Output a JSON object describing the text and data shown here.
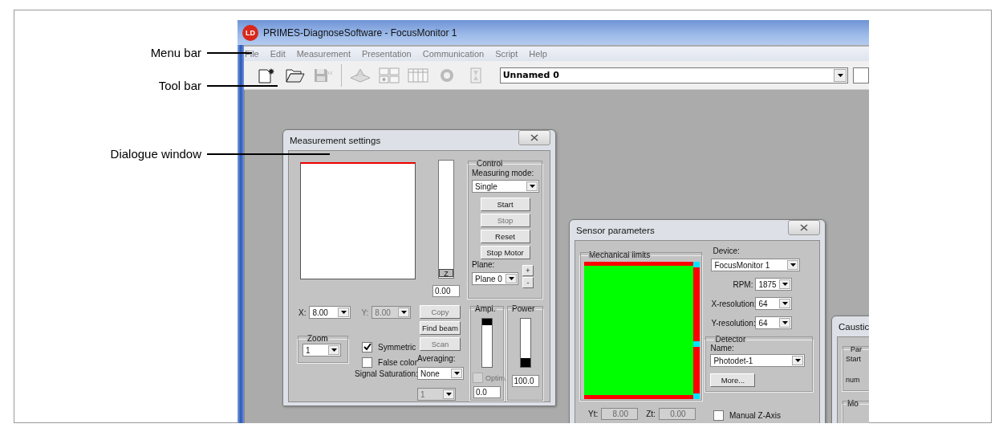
{
  "callouts": [
    {
      "label": "Menu bar"
    },
    {
      "label": "Tool bar"
    },
    {
      "label": "Dialogue window"
    }
  ],
  "app": {
    "logo": "LD",
    "title": "PRIMES-DiagnoseSoftware - FocusMonitor 1",
    "menu": [
      "File",
      "Edit",
      "Measurement",
      "Presentation",
      "Communication",
      "Script",
      "Help"
    ],
    "toolbar": [
      {
        "kind": "new",
        "disabled": false
      },
      {
        "kind": "open",
        "disabled": false
      },
      {
        "kind": "save",
        "disabled": true
      },
      {
        "kind": "separator"
      },
      {
        "kind": "plot3d",
        "disabled": true
      },
      {
        "kind": "layout",
        "disabled": true
      },
      {
        "kind": "table",
        "disabled": true
      },
      {
        "kind": "ring",
        "disabled": true
      },
      {
        "kind": "hourglass",
        "disabled": true
      }
    ],
    "document": "Unnamed 0"
  },
  "measurement_settings": {
    "title": "Measurement settings",
    "z_label": "Z",
    "z_value": "0.00",
    "control": {
      "legend": "Control",
      "mode_label": "Measuring mode:",
      "mode": "Single",
      "buttons": [
        {
          "label": "Start",
          "disabled": false
        },
        {
          "label": "Stop",
          "disabled": true
        },
        {
          "label": "Reset",
          "disabled": false
        },
        {
          "label": "Stop Motor",
          "disabled": false
        }
      ],
      "plane_label": "Plane:",
      "plane": "Plane 0",
      "plus": "+",
      "minus": "-"
    },
    "x": {
      "label": "X:",
      "value": "8.00",
      "disabled": false
    },
    "y": {
      "label": "Y:",
      "value": "8.00",
      "disabled": true
    },
    "actions": [
      {
        "label": "Copy",
        "disabled": true
      },
      {
        "label": "Find beam",
        "disabled": false
      },
      {
        "label": "Scan",
        "disabled": true
      }
    ],
    "zoom": {
      "legend": "Zoom",
      "value": "1"
    },
    "checks": [
      {
        "label": "Symmetric",
        "checked": true
      },
      {
        "label": "False color",
        "checked": false
      }
    ],
    "saturation_label": "Signal Saturation:",
    "saturation": {
      "value": "1",
      "disabled": true
    },
    "averaging_label": "Averaging:",
    "averaging": "None",
    "meters": [
      {
        "kind": "amplitude",
        "legend": "Ampl.",
        "level": 0.13,
        "value": "0.0",
        "optim": {
          "label": "Optim.",
          "checked": false,
          "disabled": true
        }
      },
      {
        "kind": "power",
        "legend": "Power",
        "level": 0.18,
        "value": "100.0"
      }
    ]
  },
  "sensor_parameters": {
    "title": "Sensor parameters",
    "limits_legend": "Mechanical limits",
    "device_label": "Device:",
    "device": "FocusMonitor 1",
    "settings": [
      {
        "label": "RPM:",
        "value": "1875"
      },
      {
        "label": "X-resolution:",
        "value": "64"
      },
      {
        "label": "Y-resolution:",
        "value": "64"
      }
    ],
    "detector": {
      "legend": "Detector",
      "name_label": "Name:",
      "name": "Photodet-1",
      "more": "More..."
    },
    "coords": [
      {
        "label": "Yt:",
        "value": "8.00",
        "disabled": true
      },
      {
        "label": "Zt:",
        "value": "0.00",
        "disabled": true
      }
    ],
    "manual_z": {
      "label": "Manual Z-Axis",
      "checked": false
    }
  },
  "caustic": {
    "title": "Caustic",
    "group_legend": "Par",
    "start_label": "Start",
    "num_label": "num",
    "group2_legend": "Mo"
  }
}
